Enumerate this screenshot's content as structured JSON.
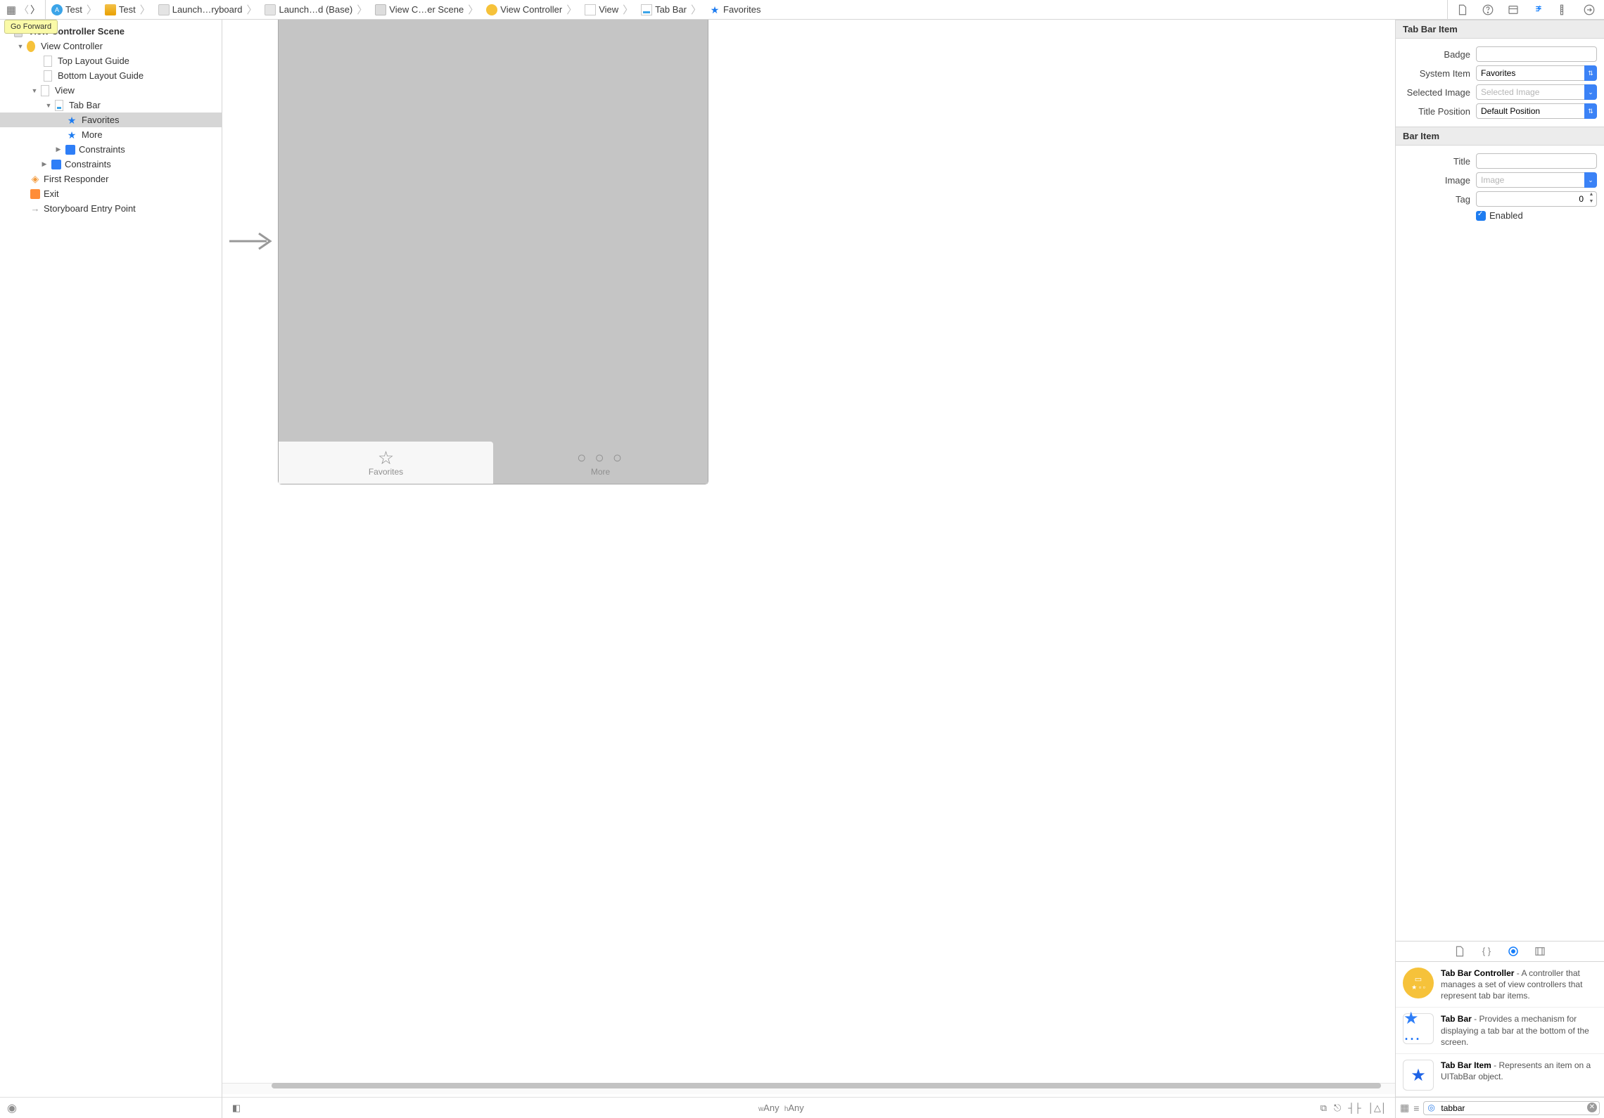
{
  "tooltip": {
    "go_forward": "Go Forward"
  },
  "breadcrumb": [
    {
      "icon": "blue-circ",
      "label": "Test"
    },
    {
      "icon": "folder",
      "label": "Test"
    },
    {
      "icon": "file",
      "label": "Launch…ryboard"
    },
    {
      "icon": "file",
      "label": "Launch…d (Base)"
    },
    {
      "icon": "scene",
      "label": "View C…er Scene"
    },
    {
      "icon": "yellow-circ",
      "label": "View Controller"
    },
    {
      "icon": "view",
      "label": "View"
    },
    {
      "icon": "tabbar",
      "label": "Tab Bar"
    },
    {
      "icon": "star",
      "label": "Favorites"
    }
  ],
  "outline": {
    "scene": "View Controller Scene",
    "vc": "View Controller",
    "top_guide": "Top Layout Guide",
    "bottom_guide": "Bottom Layout Guide",
    "view": "View",
    "tab_bar": "Tab Bar",
    "favorites": "Favorites",
    "more": "More",
    "constraints1": "Constraints",
    "constraints2": "Constraints",
    "first_responder": "First Responder",
    "exit": "Exit",
    "entry_point": "Storyboard Entry Point"
  },
  "canvas": {
    "tab_favorites": "Favorites",
    "tab_more": "More",
    "size_class": {
      "w_prefix": "w",
      "w": "Any",
      "h_prefix": "h",
      "h": "Any"
    }
  },
  "inspector": {
    "tabbaritem": {
      "header": "Tab Bar Item",
      "badge_label": "Badge",
      "badge_value": "",
      "system_item_label": "System Item",
      "system_item_value": "Favorites",
      "selected_image_label": "Selected Image",
      "selected_image_placeholder": "Selected Image",
      "title_position_label": "Title Position",
      "title_position_value": "Default Position"
    },
    "baritem": {
      "header": "Bar Item",
      "title_label": "Title",
      "title_value": "",
      "image_label": "Image",
      "image_placeholder": "Image",
      "tag_label": "Tag",
      "tag_value": "0",
      "enabled_label": "Enabled"
    }
  },
  "library": {
    "items": [
      {
        "title": "Tab Bar Controller",
        "desc": " - A controller that manages a set of view controllers that represent tab bar items."
      },
      {
        "title": "Tab Bar",
        "desc": " - Provides a mechanism for displaying a tab bar at the bottom of the screen."
      },
      {
        "title": "Tab Bar Item",
        "desc": " - Represents an item on a UITabBar object."
      }
    ],
    "search_value": "tabbar"
  }
}
